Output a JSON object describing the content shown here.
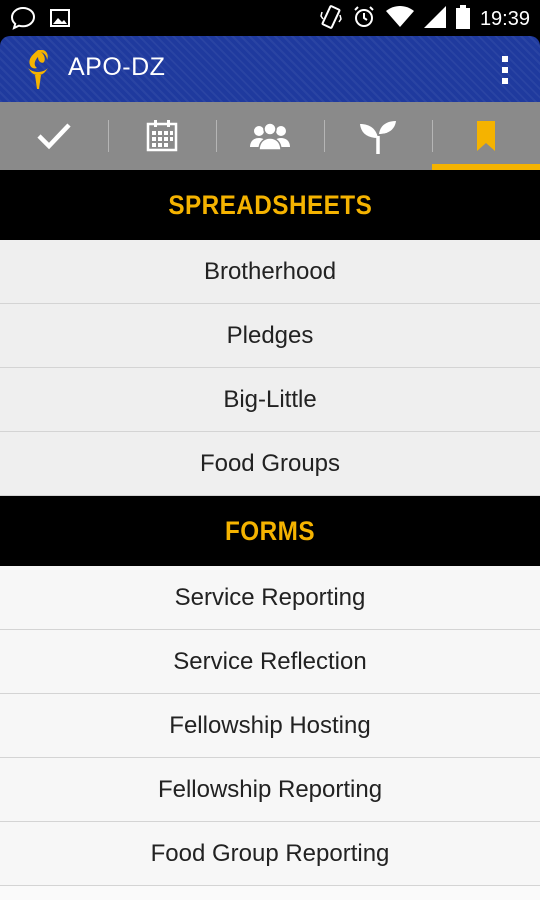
{
  "status_bar": {
    "time": "19:39",
    "icons": [
      "chat-bubble-icon",
      "image-icon",
      "vibrate-icon",
      "alarm-icon",
      "wifi-icon",
      "signal-icon",
      "battery-icon"
    ]
  },
  "app_bar": {
    "title": "APO-DZ",
    "logo": "torch-logo-icon",
    "overflow": "overflow-menu-icon",
    "brand_color": "#1f3a9e",
    "accent_color": "#f5b300"
  },
  "tabs": [
    {
      "icon": "checkmark-icon",
      "active": false
    },
    {
      "icon": "calendar-icon",
      "active": false
    },
    {
      "icon": "people-icon",
      "active": false
    },
    {
      "icon": "sprout-icon",
      "active": false
    },
    {
      "icon": "bookmark-icon",
      "active": true
    }
  ],
  "sections": {
    "spreadsheets": {
      "title": "SPREADSHEETS",
      "items": [
        "Brotherhood",
        "Pledges",
        "Big-Little",
        "Food Groups"
      ]
    },
    "forms": {
      "title": "FORMS",
      "items": [
        "Service Reporting",
        "Service Reflection",
        "Fellowship Hosting",
        "Fellowship Reporting",
        "Food Group Reporting"
      ]
    }
  }
}
